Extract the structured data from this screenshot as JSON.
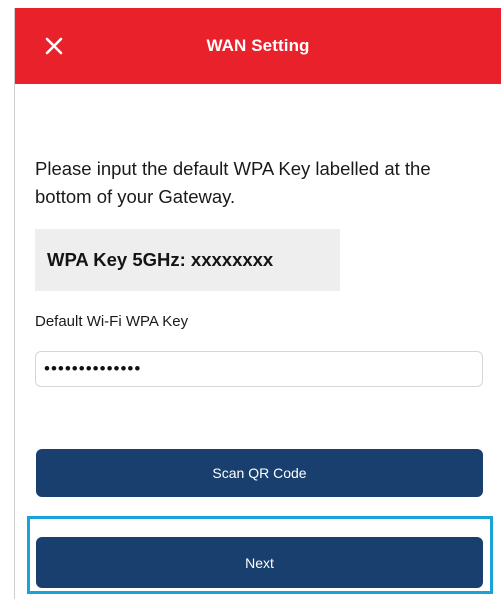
{
  "header": {
    "title": "WAN Setting",
    "close_icon": "close-icon",
    "background_color": "#e8212b"
  },
  "instructions": "Please input the default WPA Key labelled at the bottom of your Gateway.",
  "key_example": "WPA Key 5GHz: xxxxxxxx",
  "wpa_field": {
    "label": "Default Wi-Fi WPA Key",
    "value": "••••••••••••••",
    "placeholder": ""
  },
  "buttons": {
    "scan_label": "Scan QR Code",
    "next_label": "Next",
    "color": "#183f6e",
    "highlight_color": "#1aa3d9"
  }
}
